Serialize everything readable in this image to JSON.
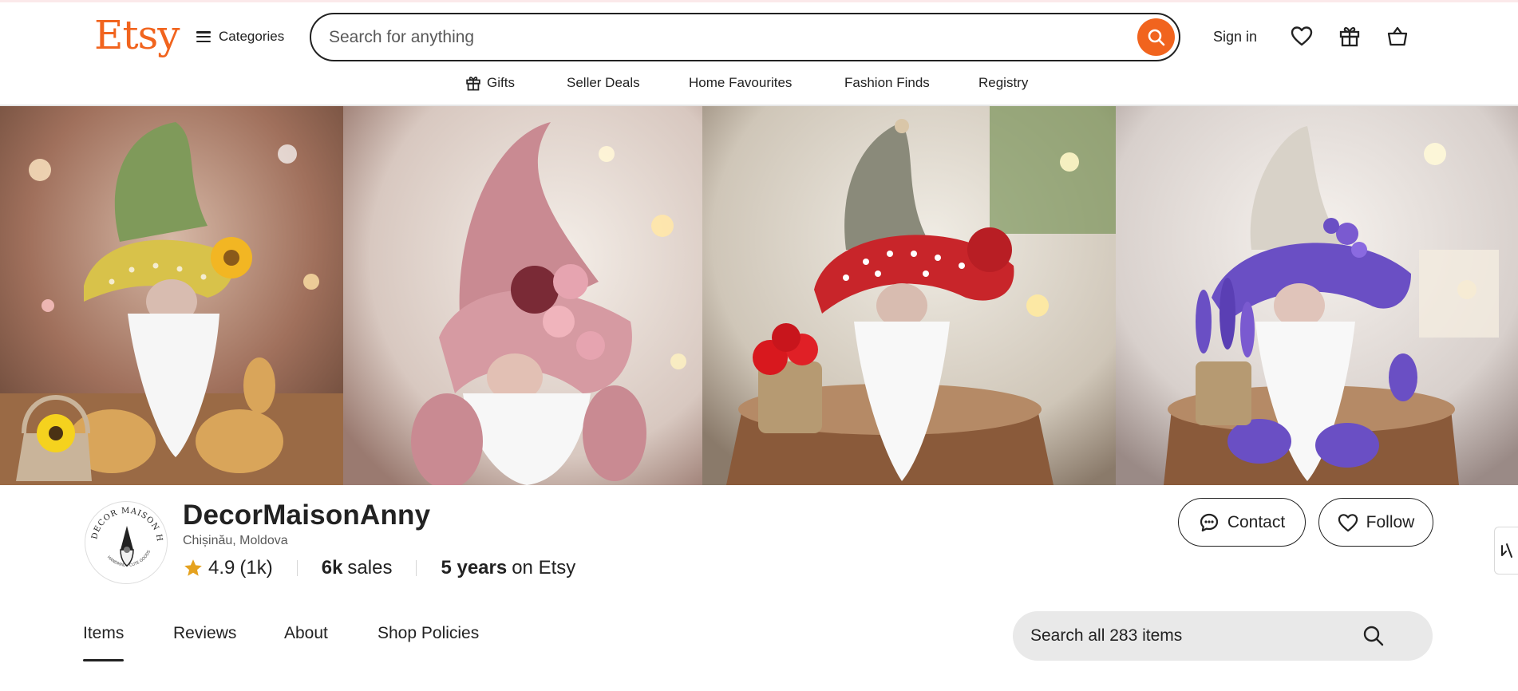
{
  "header": {
    "logo": "Etsy",
    "categories_label": "Categories",
    "search_placeholder": "Search for anything",
    "sign_in": "Sign in",
    "icons": [
      "menu-icon",
      "search-icon",
      "heart-icon",
      "gift-icon",
      "basket-icon"
    ]
  },
  "subnav": {
    "items": [
      "Gifts",
      "Seller Deals",
      "Home Favourites",
      "Fashion Finds",
      "Registry"
    ]
  },
  "banner": {
    "panels": [
      {
        "hat_color": "#7f9a5a",
        "brim_color": "#d8c24a",
        "body_color": "#d9a55a"
      },
      {
        "hat_color": "#c98a92",
        "brim_color": "#c98a92",
        "body_color": "#c98a92"
      },
      {
        "hat_color": "#8a8a7a",
        "brim_color": "#c8252a",
        "body_color": "#9a9a8a"
      },
      {
        "hat_color": "#d8d2c8",
        "brim_color": "#6a4fc4",
        "body_color": "#6a4fc4"
      }
    ]
  },
  "shop": {
    "name": "DecorMaisonAnny",
    "logo_text": "DECOR MAISON HANDMADE",
    "logo_subtext": "HANDMADE CUTE GOODS",
    "location": "Chișinău, Moldova",
    "rating": "4.9",
    "rating_count": "(1k)",
    "sales_value": "6k",
    "sales_label": "sales",
    "years_value": "5 years",
    "years_label": "on Etsy",
    "contact_label": "Contact",
    "follow_label": "Follow"
  },
  "tabs": {
    "items": [
      "Items",
      "Reviews",
      "About",
      "Shop Policies"
    ],
    "active": "Items"
  },
  "items_search": {
    "placeholder": "Search all 283 items"
  },
  "colors": {
    "brand": "#f1641e",
    "text": "#222222",
    "muted": "#595959",
    "star": "#e5a21f"
  }
}
